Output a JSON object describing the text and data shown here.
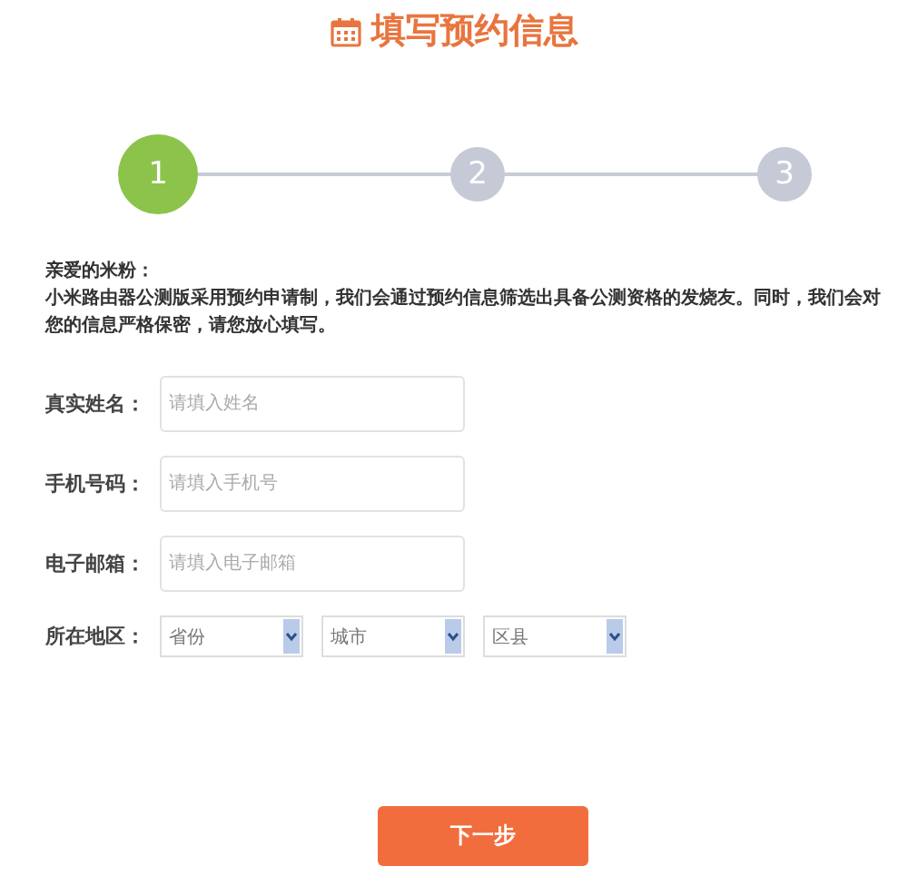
{
  "title": "填写预约信息",
  "steps": [
    {
      "label": "1",
      "selected": true
    },
    {
      "label": "2",
      "selected": false
    },
    {
      "label": "3",
      "selected": false
    }
  ],
  "greeting": "亲爱的米粉：",
  "intro": "小米路由器公测版采用预约申请制，我们会通过预约信息筛选出具备公测资格的发烧友。同时，我们会对您的信息严格保密，请您放心填写。",
  "fields": [
    {
      "label": "真实姓名：",
      "placeholder": "请填入姓名"
    },
    {
      "label": "手机号码：",
      "placeholder": "请填入手机号"
    },
    {
      "label": "电子邮箱：",
      "placeholder": "请填入电子邮箱"
    }
  ],
  "region": {
    "label": "所在地区：",
    "selects": [
      {
        "value": "省份"
      },
      {
        "value": "城市"
      },
      {
        "value": "区县"
      }
    ]
  },
  "next_button": "下一步"
}
